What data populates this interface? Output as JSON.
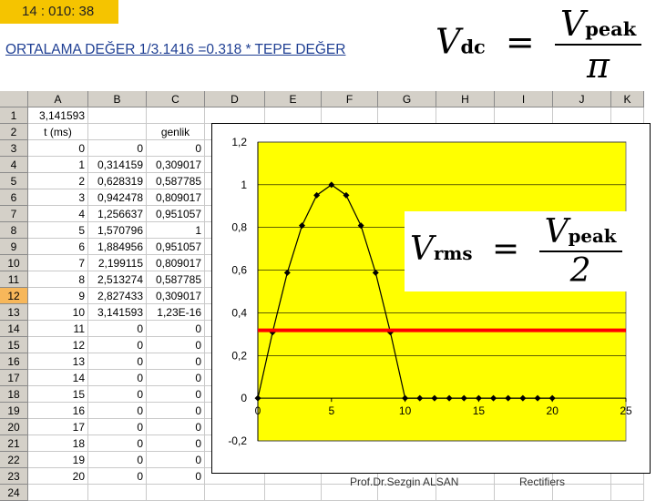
{
  "timer": "14   : 010: 38",
  "title_link": "ORTALAMA DEĞER   1/3.1416 =0.318 * TEPE DEĞER",
  "formula_vdc": {
    "lhs": "V",
    "lhs_sub": "dc",
    "equals": "=",
    "num": "V",
    "num_sub": "peak",
    "den": "π"
  },
  "formula_vrms": {
    "lhs": "V",
    "lhs_sub": "rms",
    "equals": "=",
    "num": "V",
    "num_sub": "peak",
    "den": "2"
  },
  "sheet": {
    "columns": [
      "A",
      "B",
      "C",
      "D",
      "E",
      "F",
      "G",
      "H",
      "I",
      "J",
      "K"
    ],
    "rows": [
      {
        "n": "1",
        "a": "3,141593",
        "b": "",
        "c": ""
      },
      {
        "n": "2",
        "a": "t (ms)",
        "b": "",
        "c": "genlik"
      },
      {
        "n": "3",
        "a": "0",
        "b": "0",
        "c": "0"
      },
      {
        "n": "4",
        "a": "1",
        "b": "0,314159",
        "c": "0,309017"
      },
      {
        "n": "5",
        "a": "2",
        "b": "0,628319",
        "c": "0,587785"
      },
      {
        "n": "6",
        "a": "3",
        "b": "0,942478",
        "c": "0,809017"
      },
      {
        "n": "7",
        "a": "4",
        "b": "1,256637",
        "c": "0,951057"
      },
      {
        "n": "8",
        "a": "5",
        "b": "1,570796",
        "c": "1"
      },
      {
        "n": "9",
        "a": "6",
        "b": "1,884956",
        "c": "0,951057"
      },
      {
        "n": "10",
        "a": "7",
        "b": "2,199115",
        "c": "0,809017"
      },
      {
        "n": "11",
        "a": "8",
        "b": "2,513274",
        "c": "0,587785"
      },
      {
        "n": "12",
        "a": "9",
        "b": "2,827433",
        "c": "0,309017"
      },
      {
        "n": "13",
        "a": "10",
        "b": "3,141593",
        "c": "1,23E-16"
      },
      {
        "n": "14",
        "a": "11",
        "b": "0",
        "c": "0"
      },
      {
        "n": "15",
        "a": "12",
        "b": "0",
        "c": "0"
      },
      {
        "n": "16",
        "a": "13",
        "b": "0",
        "c": "0"
      },
      {
        "n": "17",
        "a": "14",
        "b": "0",
        "c": "0"
      },
      {
        "n": "18",
        "a": "15",
        "b": "0",
        "c": "0"
      },
      {
        "n": "19",
        "a": "16",
        "b": "0",
        "c": "0"
      },
      {
        "n": "20",
        "a": "17",
        "b": "0",
        "c": "0"
      },
      {
        "n": "21",
        "a": "18",
        "b": "0",
        "c": "0"
      },
      {
        "n": "22",
        "a": "19",
        "b": "0",
        "c": "0"
      },
      {
        "n": "23",
        "a": "20",
        "b": "0",
        "c": "0"
      },
      {
        "n": "24",
        "a": "",
        "b": "",
        "c": ""
      }
    ],
    "selected_row": "12"
  },
  "chart_data": {
    "type": "line",
    "x": [
      0,
      1,
      2,
      3,
      4,
      5,
      6,
      7,
      8,
      9,
      10,
      11,
      12,
      13,
      14,
      15,
      16,
      17,
      18,
      19,
      20
    ],
    "series": [
      {
        "values": [
          0,
          0.309017,
          0.587785,
          0.809017,
          0.951057,
          1,
          0.951057,
          0.809017,
          0.587785,
          0.309017,
          0,
          0,
          0,
          0,
          0,
          0,
          0,
          0,
          0,
          0,
          0
        ]
      }
    ],
    "reference_line": 0.318,
    "xlim": [
      0,
      25
    ],
    "ylim": [
      -0.2,
      1.2
    ],
    "xticks": [
      "0",
      "5",
      "10",
      "15",
      "20",
      "25"
    ],
    "yticks": [
      "-0,2",
      "0",
      "0,2",
      "0,4",
      "0,6",
      "0,8",
      "1",
      "1,2"
    ],
    "grid": true,
    "colors": {
      "plot_bg": "#ffff00",
      "line": "#000000",
      "reference": "#ff0000"
    }
  },
  "footer": {
    "author": "Prof.Dr.Sezgin ALSAN",
    "topic": "Rectifiers"
  }
}
